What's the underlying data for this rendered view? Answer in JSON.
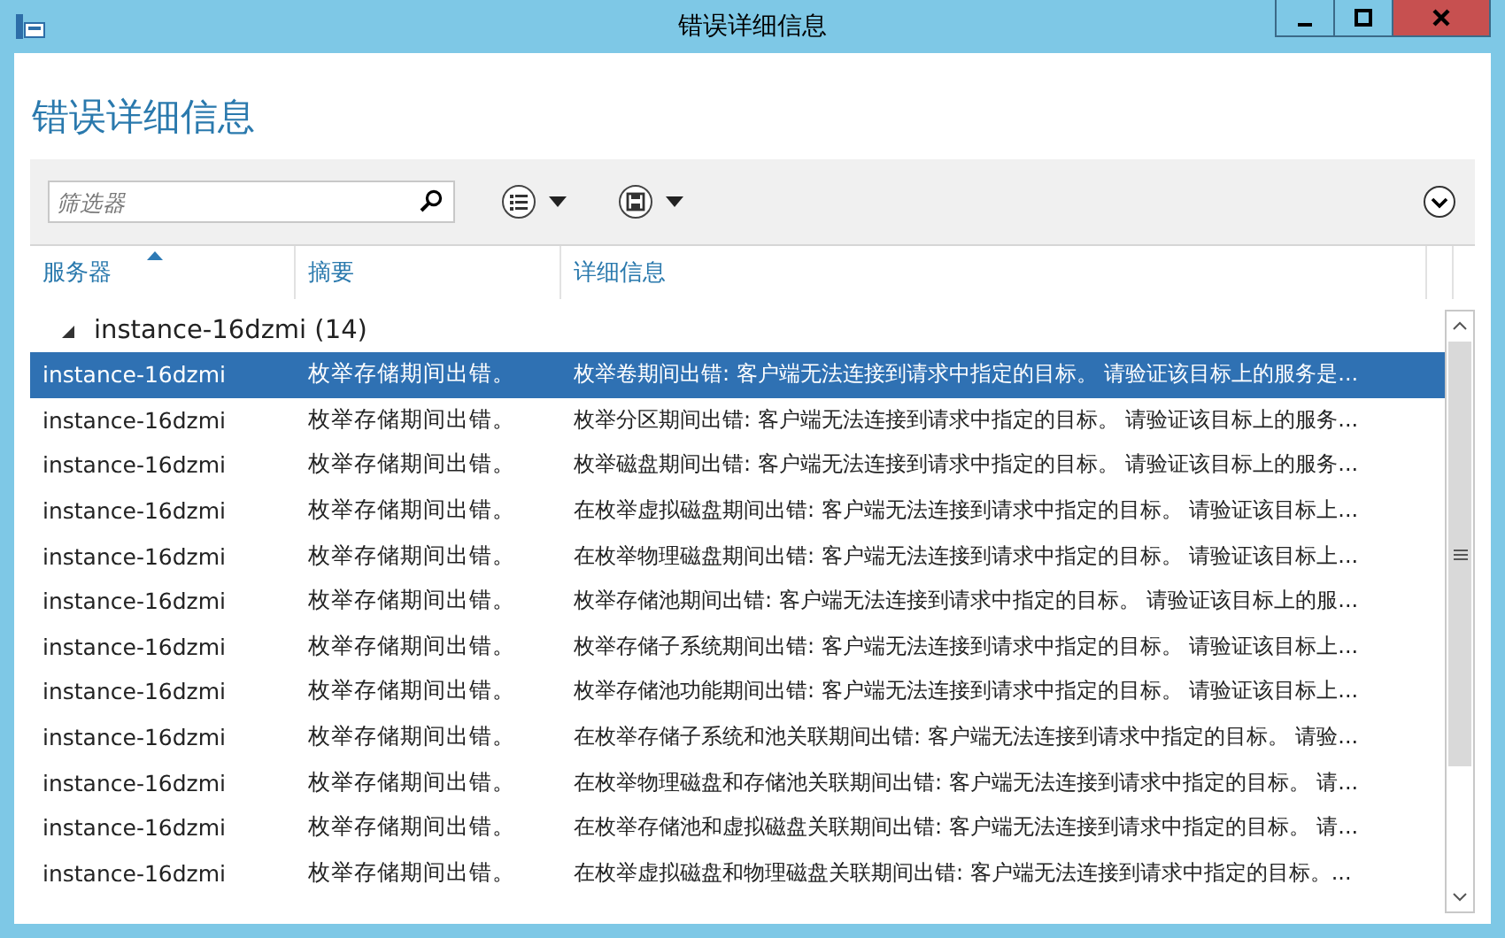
{
  "window": {
    "title": "错误详细信息"
  },
  "heading": "错误详细信息",
  "filter": {
    "placeholder": "筛选器"
  },
  "table": {
    "columns": [
      {
        "label": "服务器",
        "sorted": true
      },
      {
        "label": "摘要",
        "sorted": false
      },
      {
        "label": "详细信息",
        "sorted": false
      }
    ],
    "group": {
      "label": "instance-16dzmi (14)",
      "expanded": true
    },
    "rows": [
      {
        "server": "instance-16dzmi",
        "summary": "枚举存储期间出错。",
        "detail": "枚举卷期间出错: 客户端无法连接到请求中指定的目标。 请验证该目标上的服务是...",
        "selected": true
      },
      {
        "server": "instance-16dzmi",
        "summary": "枚举存储期间出错。",
        "detail": "枚举分区期间出错: 客户端无法连接到请求中指定的目标。 请验证该目标上的服务...",
        "selected": false
      },
      {
        "server": "instance-16dzmi",
        "summary": "枚举存储期间出错。",
        "detail": "枚举磁盘期间出错: 客户端无法连接到请求中指定的目标。 请验证该目标上的服务...",
        "selected": false
      },
      {
        "server": "instance-16dzmi",
        "summary": "枚举存储期间出错。",
        "detail": "在枚举虚拟磁盘期间出错: 客户端无法连接到请求中指定的目标。 请验证该目标上...",
        "selected": false
      },
      {
        "server": "instance-16dzmi",
        "summary": "枚举存储期间出错。",
        "detail": "在枚举物理磁盘期间出错: 客户端无法连接到请求中指定的目标。 请验证该目标上...",
        "selected": false
      },
      {
        "server": "instance-16dzmi",
        "summary": "枚举存储期间出错。",
        "detail": "枚举存储池期间出错: 客户端无法连接到请求中指定的目标。 请验证该目标上的服...",
        "selected": false
      },
      {
        "server": "instance-16dzmi",
        "summary": "枚举存储期间出错。",
        "detail": "枚举存储子系统期间出错: 客户端无法连接到请求中指定的目标。 请验证该目标上...",
        "selected": false
      },
      {
        "server": "instance-16dzmi",
        "summary": "枚举存储期间出错。",
        "detail": "枚举存储池功能期间出错: 客户端无法连接到请求中指定的目标。 请验证该目标上...",
        "selected": false
      },
      {
        "server": "instance-16dzmi",
        "summary": "枚举存储期间出错。",
        "detail": "在枚举存储子系统和池关联期间出错: 客户端无法连接到请求中指定的目标。 请验...",
        "selected": false
      },
      {
        "server": "instance-16dzmi",
        "summary": "枚举存储期间出错。",
        "detail": "在枚举物理磁盘和存储池关联期间出错: 客户端无法连接到请求中指定的目标。 请...",
        "selected": false
      },
      {
        "server": "instance-16dzmi",
        "summary": "枚举存储期间出错。",
        "detail": "在枚举存储池和虚拟磁盘关联期间出错: 客户端无法连接到请求中指定的目标。 请...",
        "selected": false
      },
      {
        "server": "instance-16dzmi",
        "summary": "枚举存储期间出错。",
        "detail": "在枚举虚拟磁盘和物理磁盘关联期间出错: 客户端无法连接到请求中指定的目标。...",
        "selected": false
      }
    ]
  }
}
